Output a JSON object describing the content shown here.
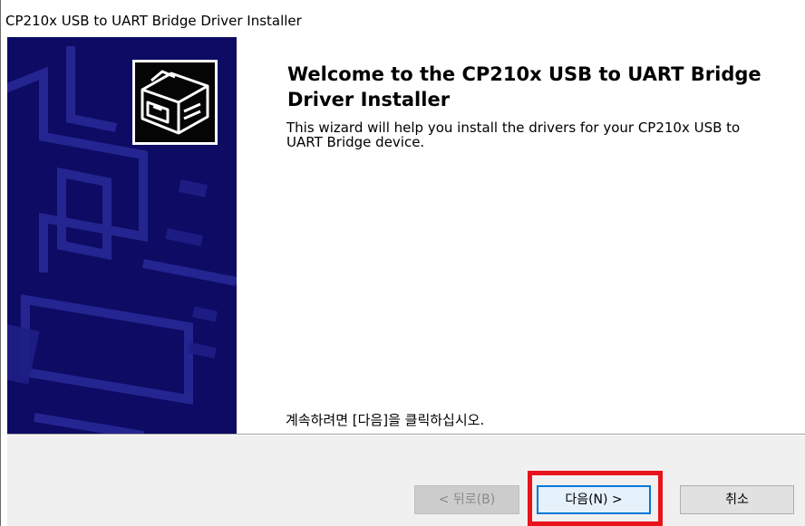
{
  "window": {
    "title": "CP210x USB to UART Bridge Driver Installer"
  },
  "welcome": {
    "heading": "Welcome to the CP210x USB to UART Bridge Driver Installer",
    "description": "This wizard will help you install the drivers for your CP210x USB to UART Bridge device.",
    "continue_instruction": "계속하려면 [다음]을 클릭하십시오."
  },
  "buttons": {
    "back_label": "< 뒤로(B)",
    "next_label": "다음(N) >",
    "cancel_label": "취소"
  },
  "colors": {
    "side_panel": "#0d0b64",
    "highlight": "#e8131b",
    "focus_border": "#0078d7"
  },
  "icons": {
    "logo": "installer-box-icon"
  }
}
